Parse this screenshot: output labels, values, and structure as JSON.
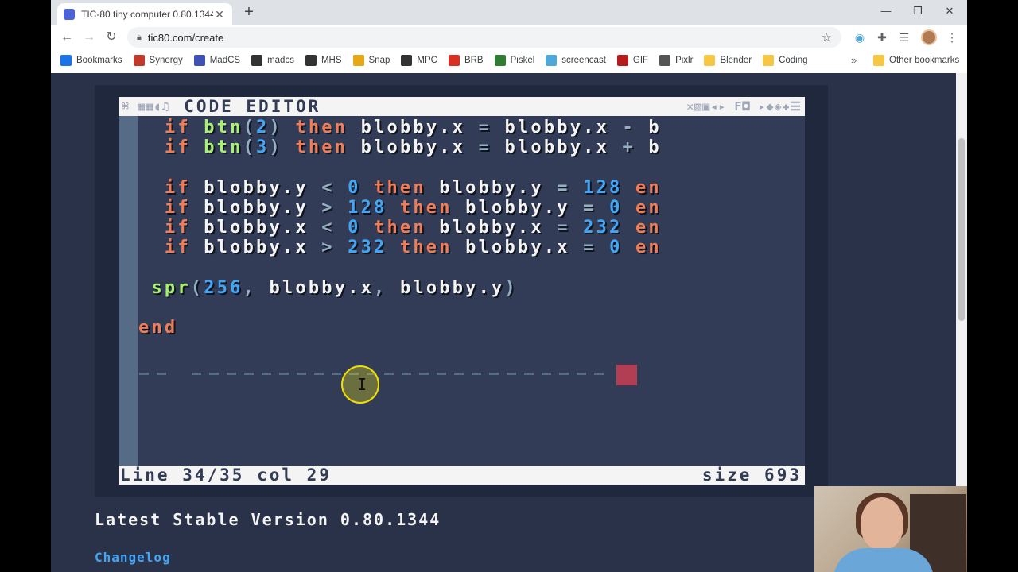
{
  "browser": {
    "tab_title": "TIC-80 tiny computer 0.80.1344 |",
    "tab_close": "✕",
    "new_tab": "+",
    "minimize": "—",
    "restore": "❐",
    "close": "✕",
    "url": "tic80.com/create",
    "bookmarks": [
      {
        "label": "Bookmarks",
        "icon": "star-icon",
        "color": "#1a73e8"
      },
      {
        "label": "Synergy",
        "icon": "synergy-icon",
        "color": "#c0392b"
      },
      {
        "label": "MadCS",
        "icon": "madcs-icon",
        "color": "#3f51b5"
      },
      {
        "label": "madcs",
        "icon": "wix-icon",
        "color": "#333333"
      },
      {
        "label": "MHS",
        "icon": "pen-icon",
        "color": "#333333"
      },
      {
        "label": "Snap",
        "icon": "snap-icon",
        "color": "#e6a817"
      },
      {
        "label": "MPC",
        "icon": "pen-icon",
        "color": "#333333"
      },
      {
        "label": "BRB",
        "icon": "asterisk-icon",
        "color": "#d93025"
      },
      {
        "label": "Piskel",
        "icon": "piskel-icon",
        "color": "#2e7d32"
      },
      {
        "label": "screencast",
        "icon": "screencast-icon",
        "color": "#4fa8d8"
      },
      {
        "label": "GIF",
        "icon": "gif-icon",
        "color": "#b71c1c"
      },
      {
        "label": "Pixlr",
        "icon": "pixlr-icon",
        "color": "#555555"
      },
      {
        "label": "Blender",
        "icon": "folder-icon",
        "color": "#f6c744"
      },
      {
        "label": "Coding",
        "icon": "folder-icon",
        "color": "#f6c744"
      }
    ],
    "bookmarks_more": "»",
    "other_bookmarks": "Other bookmarks"
  },
  "editor": {
    "title": "CODE EDITOR",
    "left_icons": "⌘ ▦▦◖♫",
    "right_icons": "✕▧▣◂▸ F◘ ▸◆◈✚☰",
    "code_lines": [
      [
        {
          "t": "  "
        },
        {
          "t": "if ",
          "c": "kw"
        },
        {
          "t": "btn",
          "c": "fn"
        },
        {
          "t": "(",
          "c": "op"
        },
        {
          "t": "2",
          "c": "num"
        },
        {
          "t": ") ",
          "c": "op"
        },
        {
          "t": "then ",
          "c": "kw"
        },
        {
          "t": "blobby.x "
        },
        {
          "t": "= ",
          "c": "op"
        },
        {
          "t": "blobby.x "
        },
        {
          "t": "- ",
          "c": "op"
        },
        {
          "t": "b"
        }
      ],
      [
        {
          "t": "  "
        },
        {
          "t": "if ",
          "c": "kw"
        },
        {
          "t": "btn",
          "c": "fn"
        },
        {
          "t": "(",
          "c": "op"
        },
        {
          "t": "3",
          "c": "num"
        },
        {
          "t": ") ",
          "c": "op"
        },
        {
          "t": "then ",
          "c": "kw"
        },
        {
          "t": "blobby.x "
        },
        {
          "t": "= ",
          "c": "op"
        },
        {
          "t": "blobby.x "
        },
        {
          "t": "+ ",
          "c": "op"
        },
        {
          "t": "b"
        }
      ],
      [
        {
          "t": " "
        }
      ],
      [
        {
          "t": "  "
        },
        {
          "t": "if ",
          "c": "kw"
        },
        {
          "t": "blobby.y "
        },
        {
          "t": "< ",
          "c": "op"
        },
        {
          "t": "0 ",
          "c": "num"
        },
        {
          "t": "then ",
          "c": "kw"
        },
        {
          "t": "blobby.y "
        },
        {
          "t": "= ",
          "c": "op"
        },
        {
          "t": "128 ",
          "c": "num"
        },
        {
          "t": "en",
          "c": "kw"
        }
      ],
      [
        {
          "t": "  "
        },
        {
          "t": "if ",
          "c": "kw"
        },
        {
          "t": "blobby.y "
        },
        {
          "t": "> ",
          "c": "op"
        },
        {
          "t": "128 ",
          "c": "num"
        },
        {
          "t": "then ",
          "c": "kw"
        },
        {
          "t": "blobby.y "
        },
        {
          "t": "= ",
          "c": "op"
        },
        {
          "t": "0 ",
          "c": "num"
        },
        {
          "t": "en",
          "c": "kw"
        }
      ],
      [
        {
          "t": "  "
        },
        {
          "t": "if ",
          "c": "kw"
        },
        {
          "t": "blobby.x "
        },
        {
          "t": "< ",
          "c": "op"
        },
        {
          "t": "0 ",
          "c": "num"
        },
        {
          "t": "then ",
          "c": "kw"
        },
        {
          "t": "blobby.x "
        },
        {
          "t": "= ",
          "c": "op"
        },
        {
          "t": "232 ",
          "c": "num"
        },
        {
          "t": "en",
          "c": "kw"
        }
      ],
      [
        {
          "t": "  "
        },
        {
          "t": "if ",
          "c": "kw"
        },
        {
          "t": "blobby.x "
        },
        {
          "t": "> ",
          "c": "op"
        },
        {
          "t": "232 ",
          "c": "num"
        },
        {
          "t": "then ",
          "c": "kw"
        },
        {
          "t": "blobby.x "
        },
        {
          "t": "= ",
          "c": "op"
        },
        {
          "t": "0 ",
          "c": "num"
        },
        {
          "t": "en",
          "c": "kw"
        }
      ],
      [
        {
          "t": " "
        }
      ],
      [
        {
          "t": " "
        },
        {
          "t": "spr",
          "c": "fn"
        },
        {
          "t": "(",
          "c": "op"
        },
        {
          "t": "256",
          "c": "num"
        },
        {
          "t": ", ",
          "c": "op"
        },
        {
          "t": "blobby.x"
        },
        {
          "t": ", ",
          "c": "op"
        },
        {
          "t": "blobby.y"
        },
        {
          "t": ")",
          "c": "op"
        }
      ],
      [
        {
          "t": " "
        }
      ],
      [
        {
          "t": "end",
          "c": "kw"
        }
      ]
    ],
    "status_line": "Line 34/35 col 29",
    "status_size": "size 693",
    "ibeam": "I"
  },
  "page": {
    "version_text": "Latest Stable Version 0.80.1344",
    "changelog": "Changelog"
  },
  "colors": {
    "keyword": "#ef7d57",
    "function": "#a7f070",
    "number": "#41a6f6",
    "cursor_block": "#b13e53",
    "screen_bg": "#333c57"
  }
}
